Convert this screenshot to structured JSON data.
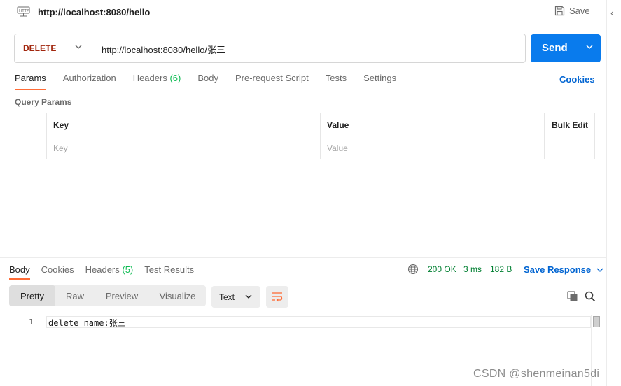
{
  "request": {
    "title": "http://localhost:8080/hello",
    "save_label": "Save",
    "method": "DELETE",
    "url": "http://localhost:8080/hello/张三",
    "send_label": "Send"
  },
  "request_tabs": [
    {
      "label": "Params",
      "count": ""
    },
    {
      "label": "Authorization",
      "count": ""
    },
    {
      "label": "Headers",
      "count": "(6)"
    },
    {
      "label": "Body",
      "count": ""
    },
    {
      "label": "Pre-request Script",
      "count": ""
    },
    {
      "label": "Tests",
      "count": ""
    },
    {
      "label": "Settings",
      "count": ""
    }
  ],
  "cookies_label": "Cookies",
  "query_params": {
    "label": "Query Params",
    "headers": {
      "key": "Key",
      "value": "Value",
      "bulk_edit": "Bulk Edit"
    },
    "placeholders": {
      "key": "Key",
      "value": "Value"
    }
  },
  "response_tabs": [
    {
      "label": "Body",
      "count": ""
    },
    {
      "label": "Cookies",
      "count": ""
    },
    {
      "label": "Headers",
      "count": "(5)"
    },
    {
      "label": "Test Results",
      "count": ""
    }
  ],
  "response_meta": {
    "status": "200 OK",
    "time": "3 ms",
    "size": "182 B",
    "save_response_label": "Save Response"
  },
  "format_options": [
    "Pretty",
    "Raw",
    "Preview",
    "Visualize"
  ],
  "format_type": "Text",
  "response_body": {
    "line_number": "1",
    "line_text": "delete name:张三"
  },
  "watermark": "CSDN @shenmeinan5di",
  "colors": {
    "method": "#a1260d",
    "send": "#097bed",
    "active_tab_underline": "#ff6c37",
    "count_green": "#0cbb52",
    "status_green": "#007f31",
    "link_blue": "#0265d2"
  }
}
